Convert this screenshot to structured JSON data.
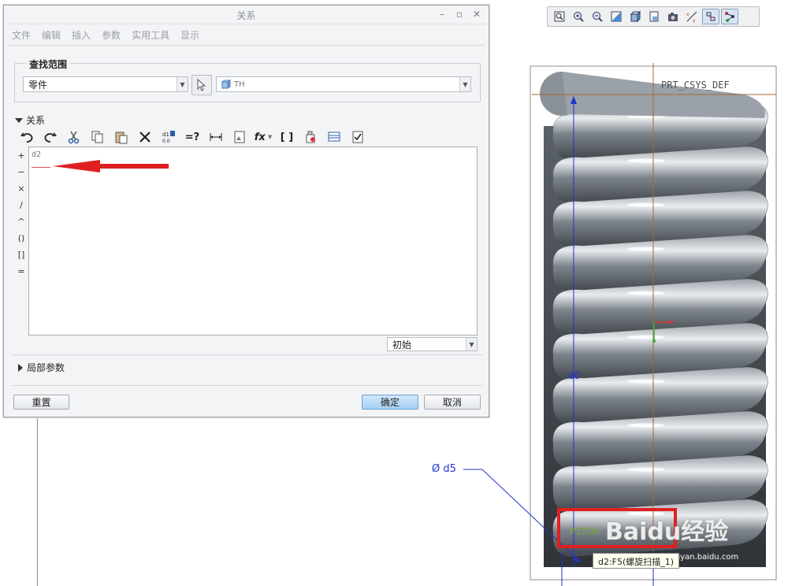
{
  "dialog": {
    "title": "关系",
    "menu": [
      "文件",
      "编辑",
      "插入",
      "参数",
      "实用工具",
      "显示"
    ],
    "scope_label": "查找范围",
    "scope_value": "零件",
    "object_value": "TH",
    "relations_label": "关系",
    "editor_text": "d2",
    "status_value": "初始",
    "local_params_label": "局部参数",
    "reset_label": "重置",
    "ok_label": "确定",
    "cancel_label": "取消",
    "operators": [
      "+",
      "−",
      "×",
      "/",
      "^",
      "()",
      "[]",
      "="
    ],
    "toolbar": {
      "fx_label": "fx",
      "eq_label": "=?",
      "brackets_label": "[ ]",
      "d1_label": "d1"
    }
  },
  "viewport": {
    "csys_label": "PRT_CSYS_DEF",
    "dim_d0": "d0",
    "dim_d5": "Ø d5",
    "pitch_label": "PITCH",
    "tooltip": "d2:F5(螺旋扫描_1)",
    "watermark": "Baidu经验",
    "watermark_sub": "jingyan.baidu.com",
    "spring_color": "#7c8288",
    "highlight_color": "#e02020"
  }
}
